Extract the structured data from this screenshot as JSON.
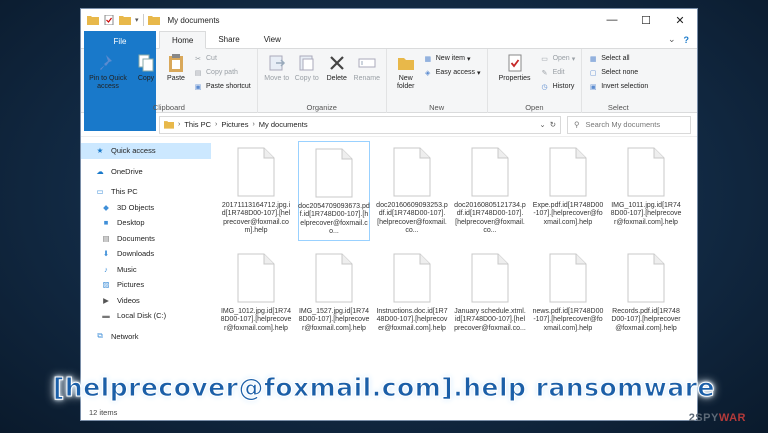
{
  "window": {
    "title": "My documents",
    "controls": {
      "minimize": "—",
      "maximize": "☐",
      "close": "✕"
    }
  },
  "tabs": {
    "file": "File",
    "home": "Home",
    "share": "Share",
    "view": "View"
  },
  "ribbon": {
    "clipboard": {
      "label": "Clipboard",
      "pin": "Pin to Quick access",
      "copy": "Copy",
      "paste": "Paste",
      "cut": "Cut",
      "copy_path": "Copy path",
      "paste_shortcut": "Paste shortcut"
    },
    "organize": {
      "label": "Organize",
      "move_to": "Move to",
      "copy_to": "Copy to",
      "delete": "Delete",
      "rename": "Rename"
    },
    "new": {
      "label": "New",
      "new_folder": "New folder",
      "new_item": "New item",
      "easy_access": "Easy access"
    },
    "open": {
      "label": "Open",
      "properties": "Properties",
      "open": "Open",
      "edit": "Edit",
      "history": "History"
    },
    "select": {
      "label": "Select",
      "select_all": "Select all",
      "select_none": "Select none",
      "invert_selection": "Invert selection"
    }
  },
  "address": {
    "crumbs": [
      "This PC",
      "Pictures",
      "My documents"
    ],
    "search_placeholder": "Search My documents"
  },
  "nav": {
    "quick_access": "Quick access",
    "onedrive": "OneDrive",
    "this_pc": "This PC",
    "objects_3d": "3D Objects",
    "desktop": "Desktop",
    "documents": "Documents",
    "downloads": "Downloads",
    "music": "Music",
    "pictures": "Pictures",
    "videos": "Videos",
    "local_disk": "Local Disk (C:)",
    "network": "Network"
  },
  "files": [
    "20171113164712.jpg.id[1R748D00-107].[helprecover@foxmail.com].help",
    "doc2054709093673.pdf.id[1R748D00-107].[helprecover@foxmail.co...",
    "doc20160609093253.pdf.id[1R748D00-107].[helprecover@foxmail.co...",
    "doc20160805121734.pdf.id[1R748D00-107].[helprecover@foxmail.co...",
    "Expe.pdf.id[1R748D00-107].[helprecover@foxmail.com].help",
    "IMG_1011.jpg.id[1R748D00-107].[helprecover@foxmail.com].help",
    "IMG_1012.jpg.id[1R748D00-107].[helprecover@foxmail.com].help",
    "IMG_1527.jpg.id[1R748D00-107].[helprecover@foxmail.com].help",
    "Instructions.doc.id[1R748D00-107].[helprecover@foxmail.com].help",
    "January schedule.xtml.id[1R748D00-107].[helprecover@foxmail.co...",
    "news.pdf.id[1R748D00-107].[helprecover@foxmail.com].help",
    "Records.pdf.id[1R748D00-107].[helprecover@foxmail.com].help"
  ],
  "status": "12 items",
  "overlay": {
    "caption": "[helprecover@foxmail.com].help ransomware",
    "watermark_prefix": "2SPY",
    "watermark_suffix": "WAR"
  },
  "colors": {
    "accent": "#1979ca",
    "selection": "#cce8ff",
    "caption": "#1b5fa8"
  }
}
